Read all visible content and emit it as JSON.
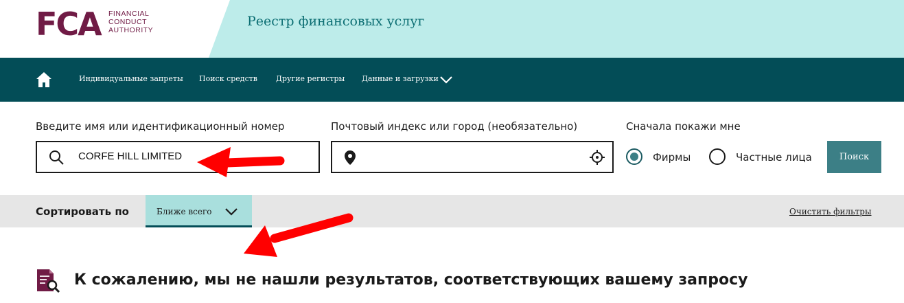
{
  "header": {
    "logo_letters": "FCA",
    "logo_lines": [
      "FINANCIAL",
      "CONDUCT",
      "AUTHORITY"
    ],
    "title": "Реестр финансовых услуг"
  },
  "nav": {
    "home_icon": "home-icon",
    "items": [
      {
        "label": "Индивидуальные запреты"
      },
      {
        "label": "Поиск средств"
      },
      {
        "label": "Другие регистры"
      },
      {
        "label": "Данные и загрузки"
      }
    ]
  },
  "search": {
    "name_label": "Введите имя или идентификационный номер",
    "name_value": "CORFE HILL LIMITED",
    "postcode_label": "Почтовый индекс или город (необязательно)",
    "postcode_value": "",
    "show_first_label": "Сначала покажи мне",
    "options": [
      {
        "label": "Фирмы",
        "checked": true
      },
      {
        "label": "Частные лица",
        "checked": false
      }
    ],
    "button_label": "Поиск"
  },
  "sort": {
    "label": "Сортировать по",
    "value": "Ближе всего",
    "clear_label": "Очистить фильтры"
  },
  "results": {
    "message": "К сожалению, мы не нашли результатов, соответствующих вашему запросу"
  },
  "colors": {
    "brand": "#701b45",
    "nav": "#034d57",
    "accent": "#3c7f86",
    "header_band": "#bdecea",
    "annotation_arrow": "#ff0000"
  }
}
